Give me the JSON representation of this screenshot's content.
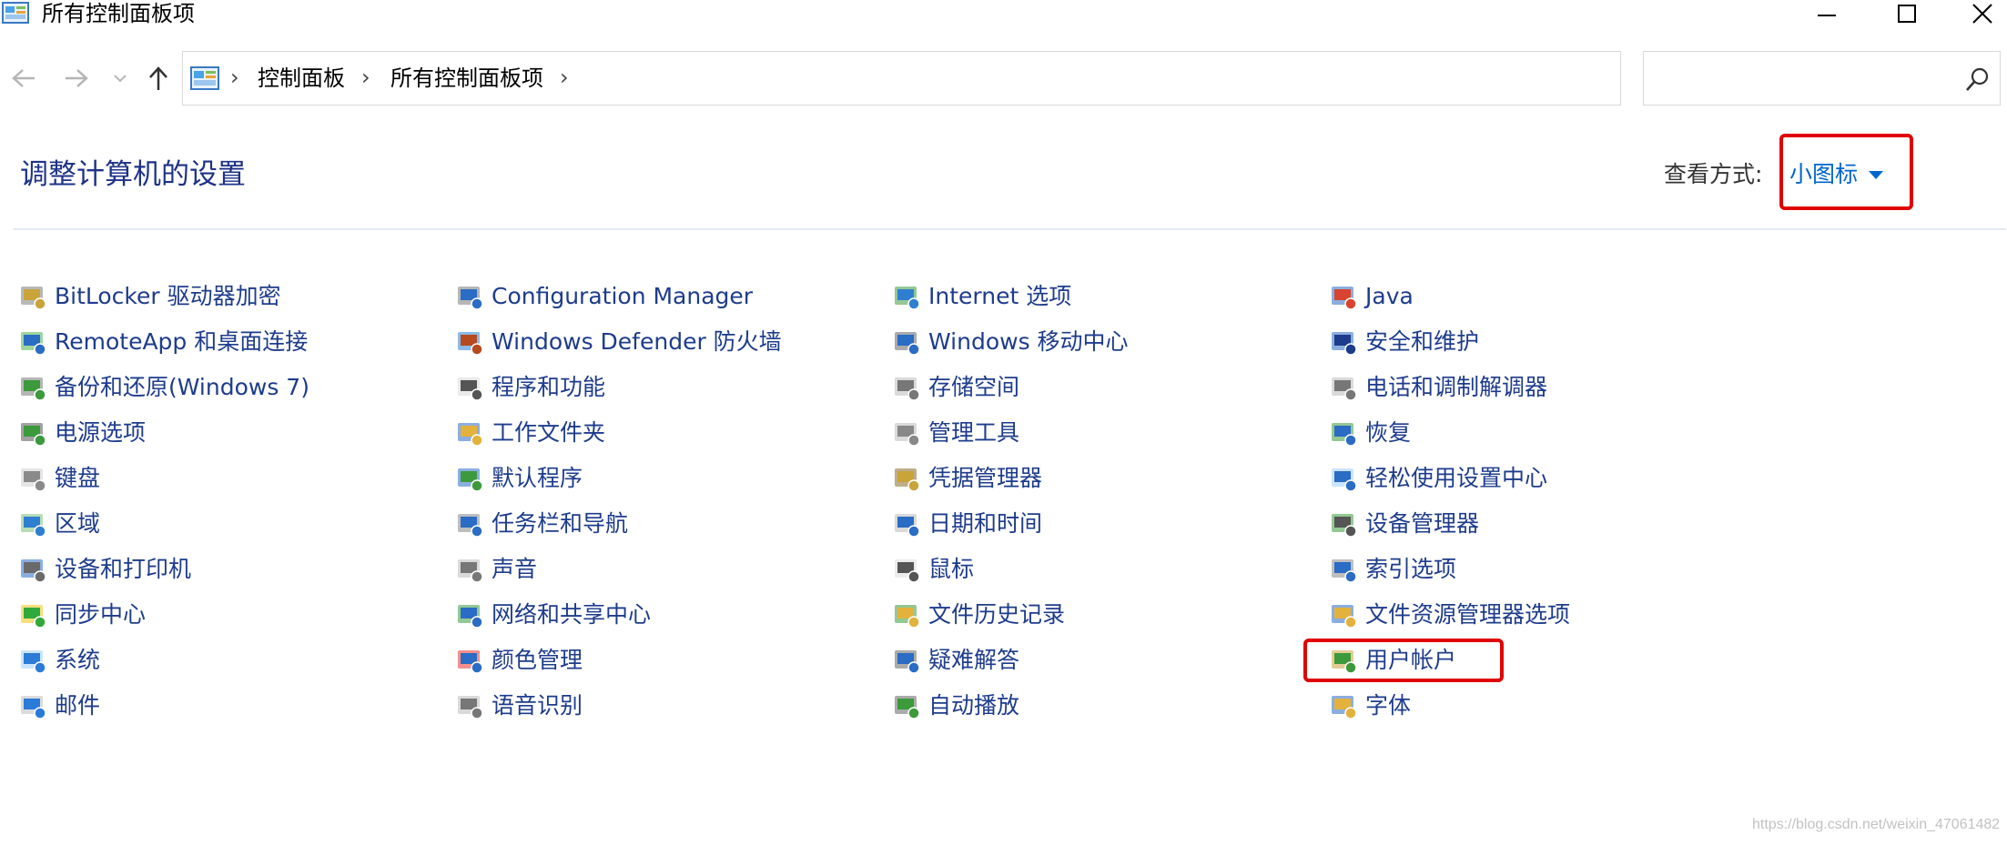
{
  "window": {
    "title": "所有控制面板项",
    "minimize_icon": "minimize-icon",
    "maximize_icon": "maximize-icon",
    "close_icon": "close-icon"
  },
  "nav": {
    "breadcrumb": [
      "控制面板",
      "所有控制面板项"
    ],
    "search_placeholder": ""
  },
  "header": {
    "title": "调整计算机的设置",
    "view_label": "查看方式:",
    "view_value": "小图标"
  },
  "columns": [
    [
      {
        "label": "BitLocker 驱动器加密",
        "icon": "bitlocker-icon"
      },
      {
        "label": "RemoteApp 和桌面连接",
        "icon": "remoteapp-icon"
      },
      {
        "label": "备份和还原(Windows 7)",
        "icon": "backup-icon"
      },
      {
        "label": "电源选项",
        "icon": "power-icon"
      },
      {
        "label": "键盘",
        "icon": "keyboard-icon"
      },
      {
        "label": "区域",
        "icon": "region-icon"
      },
      {
        "label": "设备和打印机",
        "icon": "printer-icon"
      },
      {
        "label": "同步中心",
        "icon": "sync-icon"
      },
      {
        "label": "系统",
        "icon": "system-icon"
      },
      {
        "label": "邮件",
        "icon": "mail-icon"
      }
    ],
    [
      {
        "label": "Configuration Manager",
        "icon": "config-manager-icon"
      },
      {
        "label": "Windows Defender 防火墙",
        "icon": "firewall-icon"
      },
      {
        "label": "程序和功能",
        "icon": "programs-icon"
      },
      {
        "label": "工作文件夹",
        "icon": "work-folders-icon"
      },
      {
        "label": "默认程序",
        "icon": "default-programs-icon"
      },
      {
        "label": "任务栏和导航",
        "icon": "taskbar-icon"
      },
      {
        "label": "声音",
        "icon": "sound-icon"
      },
      {
        "label": "网络和共享中心",
        "icon": "network-icon"
      },
      {
        "label": "颜色管理",
        "icon": "color-icon"
      },
      {
        "label": "语音识别",
        "icon": "microphone-icon"
      }
    ],
    [
      {
        "label": "Internet 选项",
        "icon": "internet-icon"
      },
      {
        "label": "Windows 移动中心",
        "icon": "mobility-icon"
      },
      {
        "label": "存储空间",
        "icon": "storage-icon"
      },
      {
        "label": "管理工具",
        "icon": "admin-tools-icon"
      },
      {
        "label": "凭据管理器",
        "icon": "credential-icon"
      },
      {
        "label": "日期和时间",
        "icon": "datetime-icon"
      },
      {
        "label": "鼠标",
        "icon": "mouse-icon"
      },
      {
        "label": "文件历史记录",
        "icon": "file-history-icon"
      },
      {
        "label": "疑难解答",
        "icon": "troubleshoot-icon"
      },
      {
        "label": "自动播放",
        "icon": "autoplay-icon"
      }
    ],
    [
      {
        "label": "Java",
        "icon": "java-icon"
      },
      {
        "label": "安全和维护",
        "icon": "security-flag-icon"
      },
      {
        "label": "电话和调制解调器",
        "icon": "phone-modem-icon"
      },
      {
        "label": "恢复",
        "icon": "recovery-icon"
      },
      {
        "label": "轻松使用设置中心",
        "icon": "ease-of-access-icon"
      },
      {
        "label": "设备管理器",
        "icon": "device-manager-icon"
      },
      {
        "label": "索引选项",
        "icon": "indexing-icon"
      },
      {
        "label": "文件资源管理器选项",
        "icon": "explorer-options-icon"
      },
      {
        "label": "用户帐户",
        "icon": "user-accounts-icon"
      },
      {
        "label": "字体",
        "icon": "fonts-icon"
      }
    ]
  ],
  "watermark": "https://blog.csdn.net/weixin_47061482"
}
